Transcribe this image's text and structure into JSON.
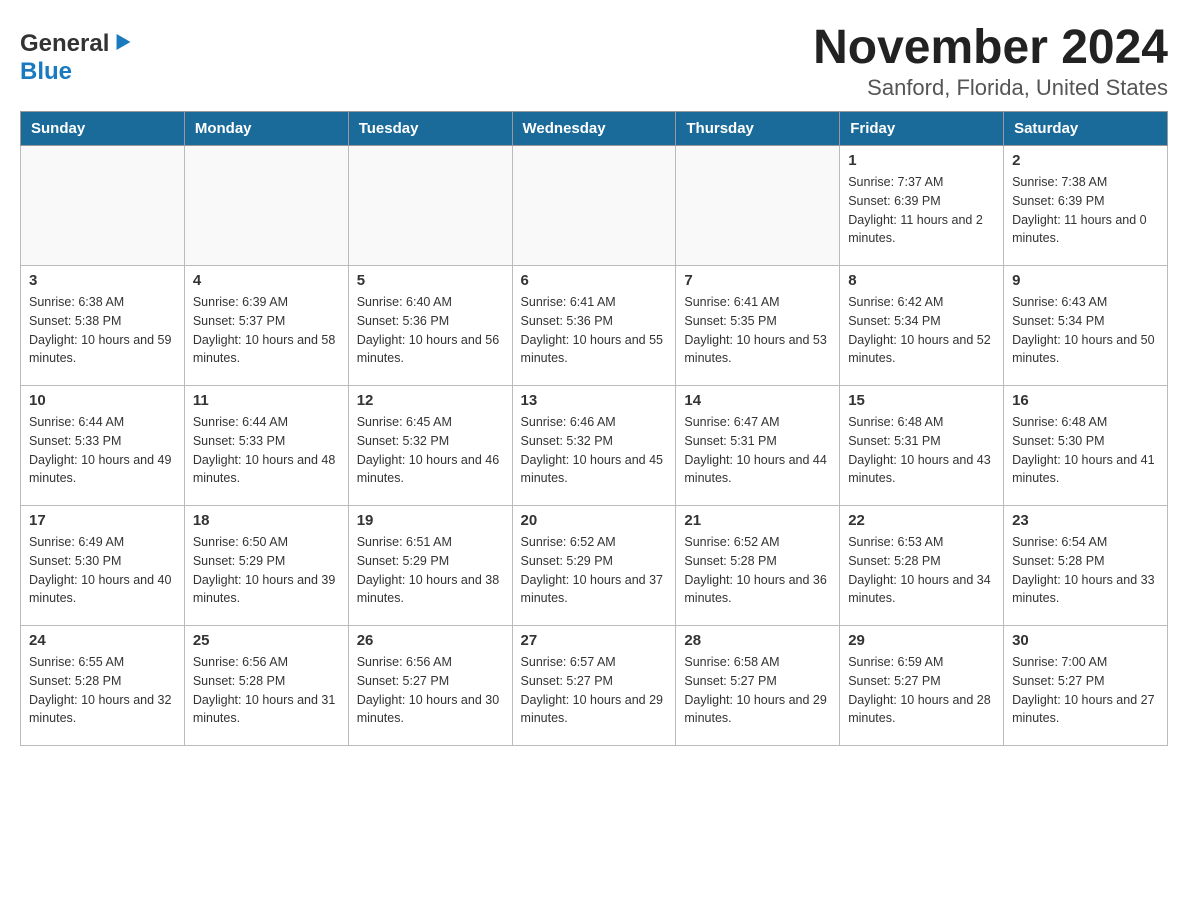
{
  "header": {
    "logo": {
      "general": "General",
      "blue": "Blue",
      "tagline": ""
    },
    "title": "November 2024",
    "subtitle": "Sanford, Florida, United States"
  },
  "days_of_week": [
    "Sunday",
    "Monday",
    "Tuesday",
    "Wednesday",
    "Thursday",
    "Friday",
    "Saturday"
  ],
  "weeks": [
    [
      {
        "day": "",
        "sunrise": "",
        "sunset": "",
        "daylight": ""
      },
      {
        "day": "",
        "sunrise": "",
        "sunset": "",
        "daylight": ""
      },
      {
        "day": "",
        "sunrise": "",
        "sunset": "",
        "daylight": ""
      },
      {
        "day": "",
        "sunrise": "",
        "sunset": "",
        "daylight": ""
      },
      {
        "day": "",
        "sunrise": "",
        "sunset": "",
        "daylight": ""
      },
      {
        "day": "1",
        "sunrise": "Sunrise: 7:37 AM",
        "sunset": "Sunset: 6:39 PM",
        "daylight": "Daylight: 11 hours and 2 minutes."
      },
      {
        "day": "2",
        "sunrise": "Sunrise: 7:38 AM",
        "sunset": "Sunset: 6:39 PM",
        "daylight": "Daylight: 11 hours and 0 minutes."
      }
    ],
    [
      {
        "day": "3",
        "sunrise": "Sunrise: 6:38 AM",
        "sunset": "Sunset: 5:38 PM",
        "daylight": "Daylight: 10 hours and 59 minutes."
      },
      {
        "day": "4",
        "sunrise": "Sunrise: 6:39 AM",
        "sunset": "Sunset: 5:37 PM",
        "daylight": "Daylight: 10 hours and 58 minutes."
      },
      {
        "day": "5",
        "sunrise": "Sunrise: 6:40 AM",
        "sunset": "Sunset: 5:36 PM",
        "daylight": "Daylight: 10 hours and 56 minutes."
      },
      {
        "day": "6",
        "sunrise": "Sunrise: 6:41 AM",
        "sunset": "Sunset: 5:36 PM",
        "daylight": "Daylight: 10 hours and 55 minutes."
      },
      {
        "day": "7",
        "sunrise": "Sunrise: 6:41 AM",
        "sunset": "Sunset: 5:35 PM",
        "daylight": "Daylight: 10 hours and 53 minutes."
      },
      {
        "day": "8",
        "sunrise": "Sunrise: 6:42 AM",
        "sunset": "Sunset: 5:34 PM",
        "daylight": "Daylight: 10 hours and 52 minutes."
      },
      {
        "day": "9",
        "sunrise": "Sunrise: 6:43 AM",
        "sunset": "Sunset: 5:34 PM",
        "daylight": "Daylight: 10 hours and 50 minutes."
      }
    ],
    [
      {
        "day": "10",
        "sunrise": "Sunrise: 6:44 AM",
        "sunset": "Sunset: 5:33 PM",
        "daylight": "Daylight: 10 hours and 49 minutes."
      },
      {
        "day": "11",
        "sunrise": "Sunrise: 6:44 AM",
        "sunset": "Sunset: 5:33 PM",
        "daylight": "Daylight: 10 hours and 48 minutes."
      },
      {
        "day": "12",
        "sunrise": "Sunrise: 6:45 AM",
        "sunset": "Sunset: 5:32 PM",
        "daylight": "Daylight: 10 hours and 46 minutes."
      },
      {
        "day": "13",
        "sunrise": "Sunrise: 6:46 AM",
        "sunset": "Sunset: 5:32 PM",
        "daylight": "Daylight: 10 hours and 45 minutes."
      },
      {
        "day": "14",
        "sunrise": "Sunrise: 6:47 AM",
        "sunset": "Sunset: 5:31 PM",
        "daylight": "Daylight: 10 hours and 44 minutes."
      },
      {
        "day": "15",
        "sunrise": "Sunrise: 6:48 AM",
        "sunset": "Sunset: 5:31 PM",
        "daylight": "Daylight: 10 hours and 43 minutes."
      },
      {
        "day": "16",
        "sunrise": "Sunrise: 6:48 AM",
        "sunset": "Sunset: 5:30 PM",
        "daylight": "Daylight: 10 hours and 41 minutes."
      }
    ],
    [
      {
        "day": "17",
        "sunrise": "Sunrise: 6:49 AM",
        "sunset": "Sunset: 5:30 PM",
        "daylight": "Daylight: 10 hours and 40 minutes."
      },
      {
        "day": "18",
        "sunrise": "Sunrise: 6:50 AM",
        "sunset": "Sunset: 5:29 PM",
        "daylight": "Daylight: 10 hours and 39 minutes."
      },
      {
        "day": "19",
        "sunrise": "Sunrise: 6:51 AM",
        "sunset": "Sunset: 5:29 PM",
        "daylight": "Daylight: 10 hours and 38 minutes."
      },
      {
        "day": "20",
        "sunrise": "Sunrise: 6:52 AM",
        "sunset": "Sunset: 5:29 PM",
        "daylight": "Daylight: 10 hours and 37 minutes."
      },
      {
        "day": "21",
        "sunrise": "Sunrise: 6:52 AM",
        "sunset": "Sunset: 5:28 PM",
        "daylight": "Daylight: 10 hours and 36 minutes."
      },
      {
        "day": "22",
        "sunrise": "Sunrise: 6:53 AM",
        "sunset": "Sunset: 5:28 PM",
        "daylight": "Daylight: 10 hours and 34 minutes."
      },
      {
        "day": "23",
        "sunrise": "Sunrise: 6:54 AM",
        "sunset": "Sunset: 5:28 PM",
        "daylight": "Daylight: 10 hours and 33 minutes."
      }
    ],
    [
      {
        "day": "24",
        "sunrise": "Sunrise: 6:55 AM",
        "sunset": "Sunset: 5:28 PM",
        "daylight": "Daylight: 10 hours and 32 minutes."
      },
      {
        "day": "25",
        "sunrise": "Sunrise: 6:56 AM",
        "sunset": "Sunset: 5:28 PM",
        "daylight": "Daylight: 10 hours and 31 minutes."
      },
      {
        "day": "26",
        "sunrise": "Sunrise: 6:56 AM",
        "sunset": "Sunset: 5:27 PM",
        "daylight": "Daylight: 10 hours and 30 minutes."
      },
      {
        "day": "27",
        "sunrise": "Sunrise: 6:57 AM",
        "sunset": "Sunset: 5:27 PM",
        "daylight": "Daylight: 10 hours and 29 minutes."
      },
      {
        "day": "28",
        "sunrise": "Sunrise: 6:58 AM",
        "sunset": "Sunset: 5:27 PM",
        "daylight": "Daylight: 10 hours and 29 minutes."
      },
      {
        "day": "29",
        "sunrise": "Sunrise: 6:59 AM",
        "sunset": "Sunset: 5:27 PM",
        "daylight": "Daylight: 10 hours and 28 minutes."
      },
      {
        "day": "30",
        "sunrise": "Sunrise: 7:00 AM",
        "sunset": "Sunset: 5:27 PM",
        "daylight": "Daylight: 10 hours and 27 minutes."
      }
    ]
  ]
}
